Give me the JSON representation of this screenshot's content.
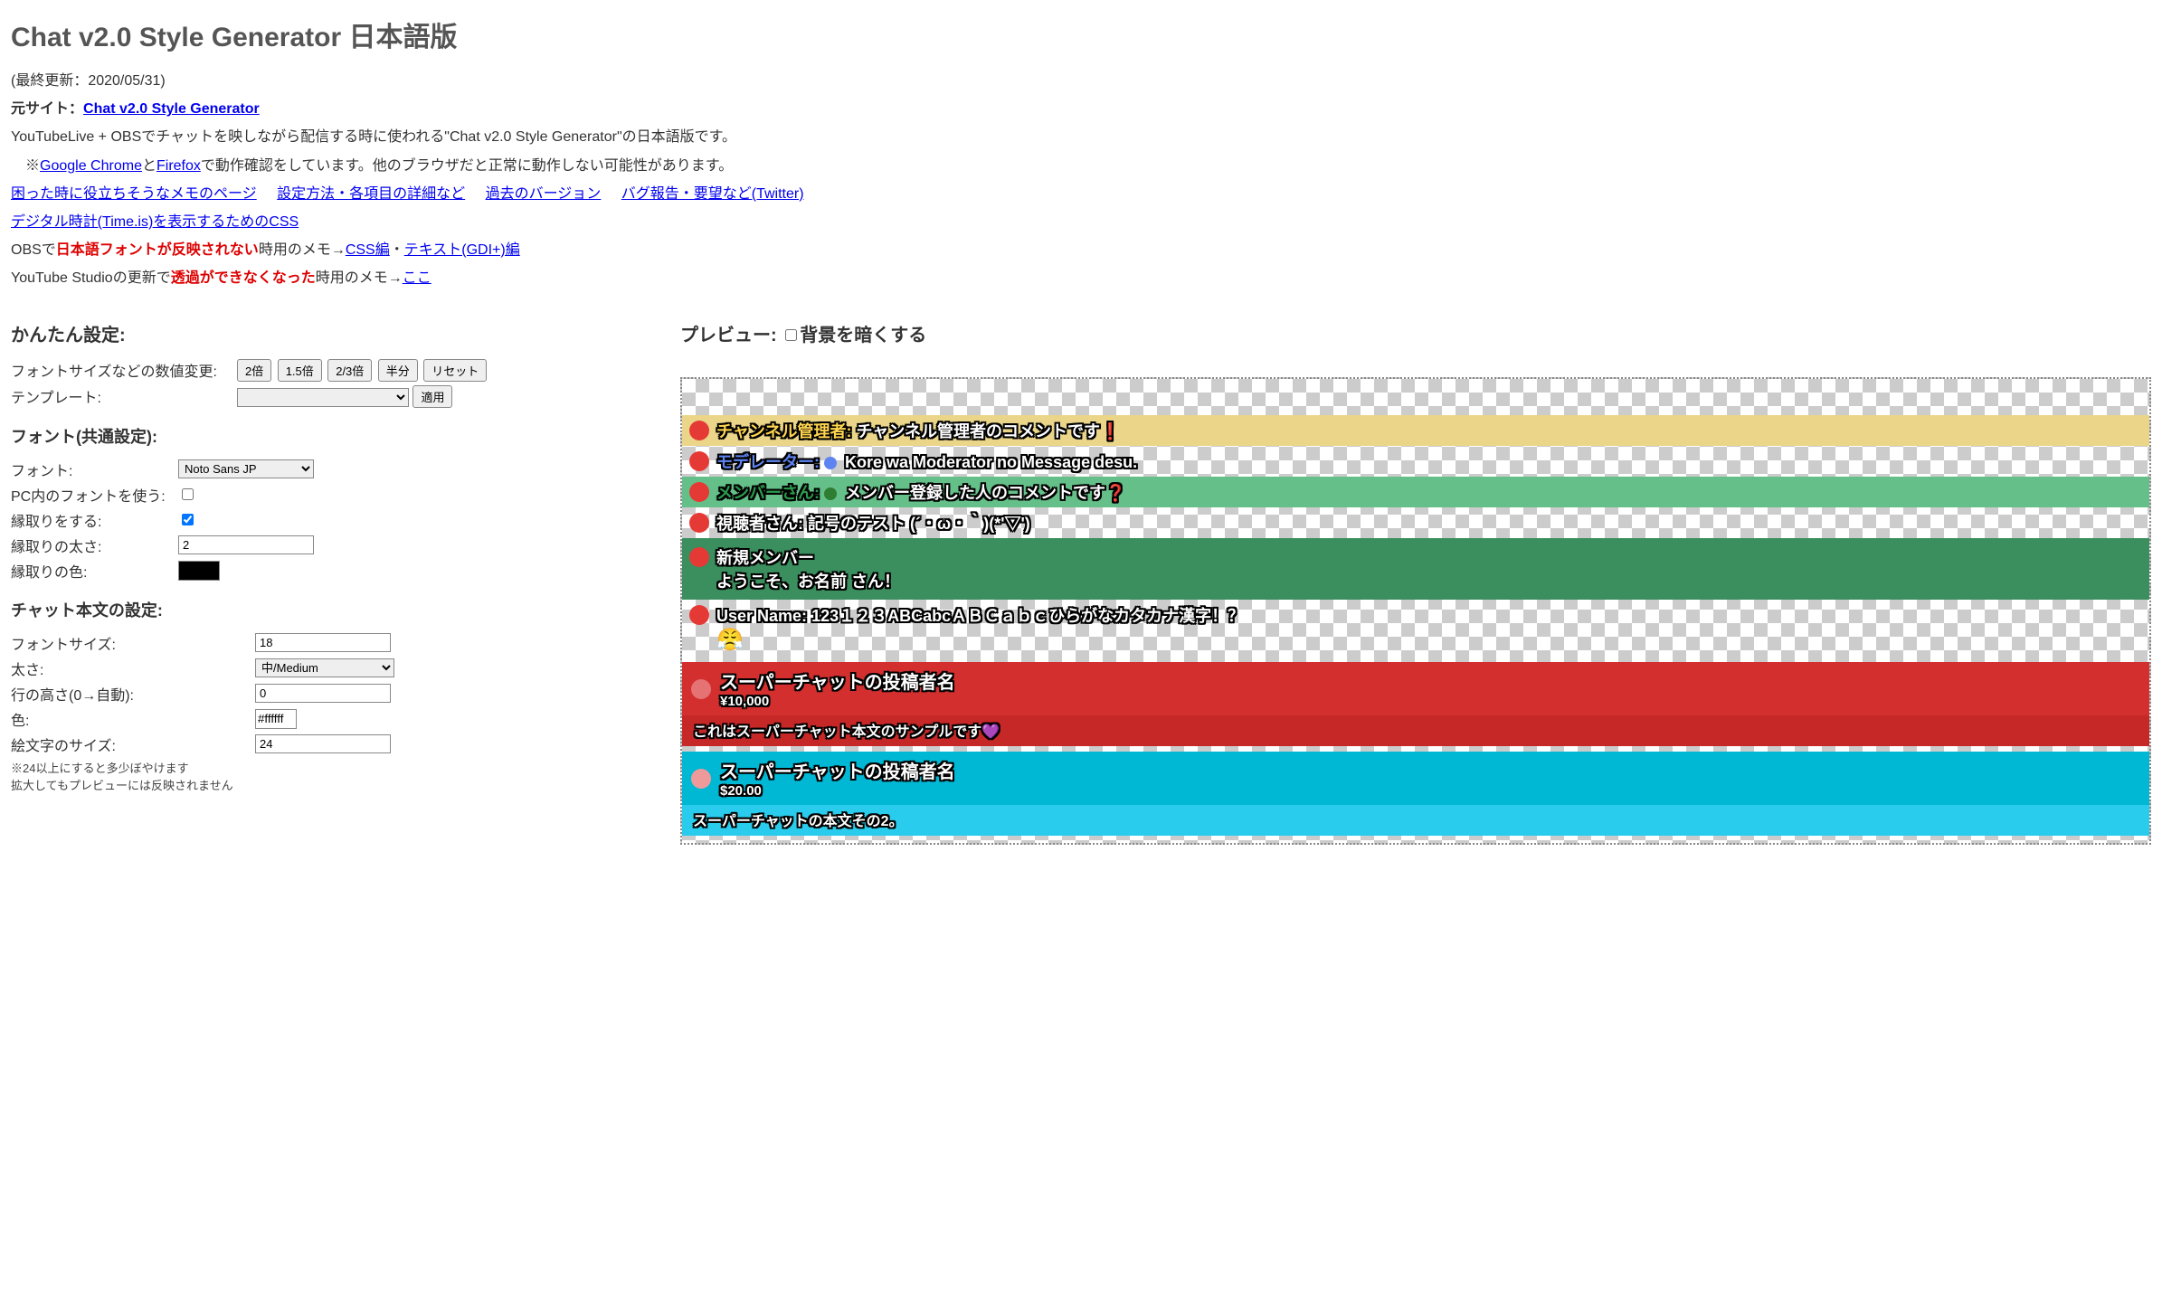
{
  "title": "Chat v2.0 Style Generator 日本語版",
  "last_updated": "(最終更新：2020/05/31)",
  "source_prefix": "元サイト：",
  "source_link": "Chat v2.0 Style Generator",
  "desc": "YouTubeLive + OBSでチャットを映しながら配信する時に使われる\"Chat v2.0 Style Generator\"の日本語版です。",
  "browser_note_prefix": "　※",
  "browser_link1": "Google Chrome",
  "browser_and": "と",
  "browser_link2": "Firefox",
  "browser_note_suffix": "で動作確認をしています。他のブラウザだと正常に動作しない可能性があります。",
  "help_links": {
    "memo": "困った時に役立ちそうなメモのページ",
    "settings": "設定方法・各項目の詳細など",
    "past": "過去のバージョン",
    "twitter": "バグ報告・要望など(Twitter)",
    "timeis": "デジタル時計(Time.is)を表示するためのCSS"
  },
  "obs_note_prefix": "OBSで",
  "obs_note_red": "日本語フォントが反映されない",
  "obs_note_mid": "時用のメモ→",
  "obs_link_css": "CSS編",
  "obs_dot": "・",
  "obs_link_gdi": "テキスト(GDI+)編",
  "yt_note_prefix": "YouTube Studioの更新で",
  "yt_note_red": "透過ができなくなった",
  "yt_note_mid": "時用のメモ→",
  "yt_link": "ここ",
  "easy": {
    "heading": "かんたん設定:",
    "scale_label": "フォントサイズなどの数値変更:",
    "btn_2x": "2倍",
    "btn_1_5x": "1.5倍",
    "btn_2_3x": "2/3倍",
    "btn_half": "半分",
    "btn_reset": "リセット",
    "template_label": "テンプレート:",
    "apply": "適用"
  },
  "font": {
    "heading": "フォント(共通設定):",
    "label_font": "フォント:",
    "value_font": "Noto Sans JP",
    "label_pcfont": "PC内のフォントを使う:",
    "pcfont_checked": false,
    "label_outline": "縁取りをする:",
    "outline_checked": true,
    "label_outline_w": "縁取りの太さ:",
    "value_outline_w": "2",
    "label_outline_c": "縁取りの色:",
    "value_outline_c": "#000000"
  },
  "chatbody": {
    "heading": "チャット本文の設定:",
    "label_size": "フォントサイズ:",
    "value_size": "18",
    "label_weight": "太さ:",
    "value_weight": "中/Medium",
    "label_lineheight": "行の高さ(0→自動):",
    "value_lineheight": "0",
    "label_color": "色:",
    "value_color": "#ffffff",
    "label_emoji": "絵文字のサイズ:",
    "value_emoji": "24",
    "note1": "※24以上にすると多少ぼやけます",
    "note2": "拡大してもプレビューには反映されません"
  },
  "preview": {
    "heading": "プレビュー: ",
    "dark_label": "背景を暗くする",
    "lines": {
      "owner_name": "チャンネル管理者:",
      "owner_msg": "チャンネル管理者のコメントです❗",
      "mod_name": "モデレーター:",
      "mod_msg": "Kore wa Moderator no Message desu.",
      "member_name": "メンバーさん:",
      "member_msg": "メンバー登録した人のコメントです❓",
      "viewer_name": "視聴者さん:",
      "viewer_msg": "記号のテスト (´・ω・｀)(*'▽')",
      "newmember_title": "新規メンバー",
      "newmember_msg": "ようこそ、お名前 さん！",
      "user_name": "User Name:",
      "user_msg": "123１２３ABCabcＡＢＣａｂｃひらがなカタカナ漢字！？",
      "user_emoji": "😤"
    },
    "superchat1": {
      "name": "スーパーチャットの投稿者名",
      "amount": "¥10,000",
      "body": "これはスーパーチャット本文のサンプルです💜"
    },
    "superchat2": {
      "name": "スーパーチャットの投稿者名",
      "amount": "$20.00",
      "body": "スーパーチャットの本文その2。"
    }
  }
}
